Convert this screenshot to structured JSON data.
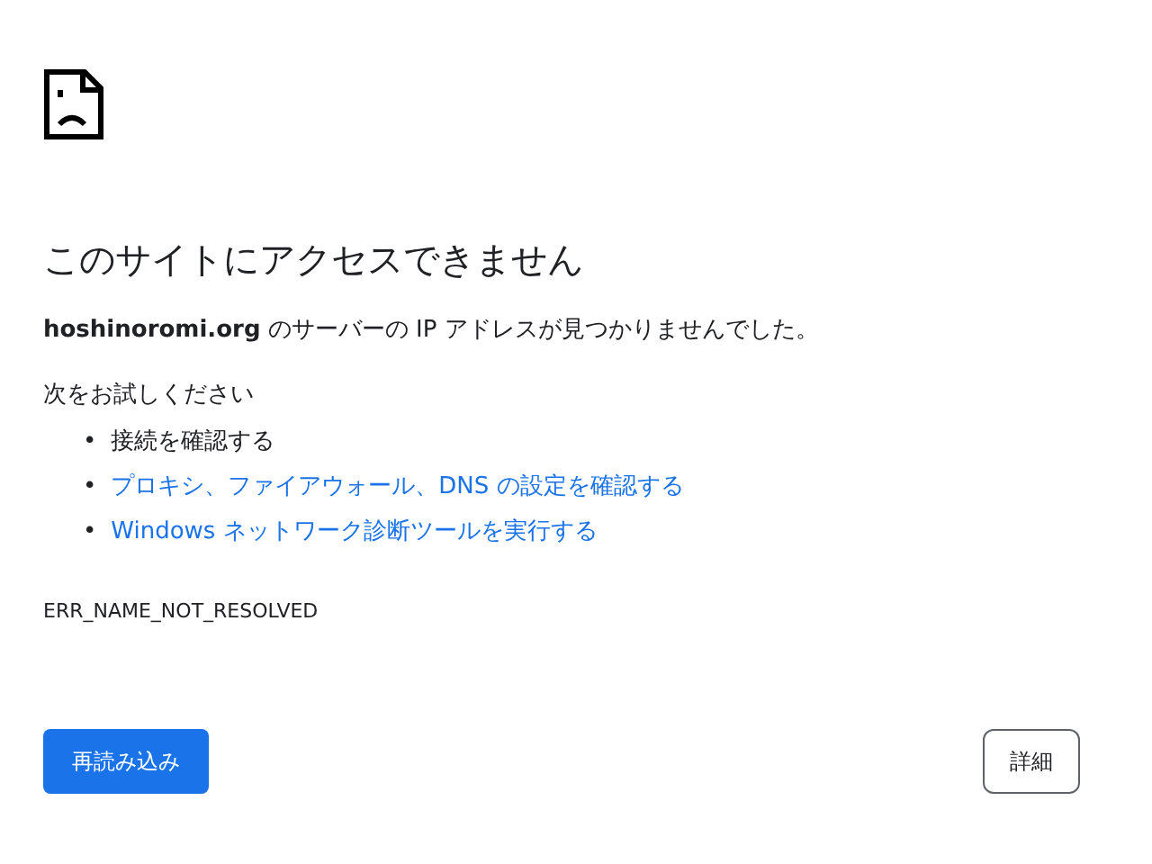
{
  "title": "このサイトにアクセスできません",
  "description": "**hoshinoromi.org** のサーバーの IP アドレスが見つかりませんでした。",
  "suggestions_heading": "次をお試しください",
  "suggestions": [
    {
      "kind": "text",
      "marker": "•",
      "text": "接続を確認する"
    },
    {
      "kind": "link",
      "marker": "•",
      "text": "プロキシ、ファイアウォール、DNS の設定を確認する"
    },
    {
      "kind": "link",
      "marker": "•",
      "text": "Windows ネットワーク診断ツールを実行する"
    }
  ],
  "error_code": "ERR_NAME_NOT_RESOLVED",
  "buttons": [
    {
      "kind": "primary",
      "label": "再読み込み"
    },
    {
      "kind": "secondary",
      "label": "詳細"
    }
  ]
}
